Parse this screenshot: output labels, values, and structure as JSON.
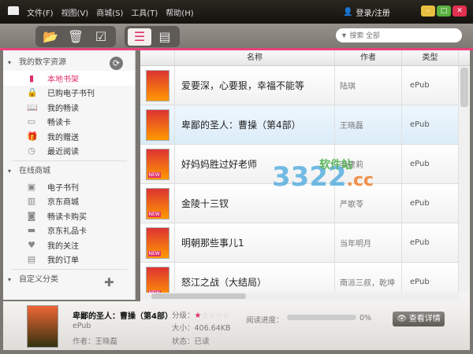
{
  "menu": {
    "items": [
      "文件(F)",
      "视图(V)",
      "商城(S)",
      "工具(T)",
      "帮助(H)"
    ],
    "login": "登录/注册"
  },
  "search": {
    "placeholder": "▼ 搜索 全部"
  },
  "sidebar": {
    "sections": [
      {
        "title": "我的数字资源",
        "items": [
          {
            "label": "本地书架",
            "icon": "bookshelf-icon"
          },
          {
            "label": "已购电子书刊",
            "icon": "bag-icon"
          },
          {
            "label": "我的畅读",
            "icon": "book-icon"
          },
          {
            "label": "畅读卡",
            "icon": "card-icon"
          },
          {
            "label": "我的赠送",
            "icon": "gift-icon"
          },
          {
            "label": "最近阅读",
            "icon": "clock-icon"
          }
        ]
      },
      {
        "title": "在线商城",
        "items": [
          {
            "label": "电子书刊",
            "icon": "ebook-icon"
          },
          {
            "label": "京东商城",
            "icon": "store-icon"
          },
          {
            "label": "畅读卡购买",
            "icon": "buy-card-icon"
          },
          {
            "label": "京东礼品卡",
            "icon": "giftcard-icon"
          },
          {
            "label": "我的关注",
            "icon": "heart-icon"
          },
          {
            "label": "我的订单",
            "icon": "order-icon"
          }
        ]
      },
      {
        "title": "自定义分类",
        "items": []
      }
    ]
  },
  "table": {
    "headers": [
      "名称",
      "作者",
      "类型"
    ],
    "rows": [
      {
        "title": "爱要深，心要狠，幸福不能等",
        "author": "陆琪",
        "type": "ePub"
      },
      {
        "title": "卑鄙的圣人：曹操（第4部）",
        "author": "王晓磊",
        "type": "ePub"
      },
      {
        "title": "好妈妈胜过好老师",
        "author": "尹建莉",
        "type": "ePub",
        "badge": "NEW"
      },
      {
        "title": "金陵十三钗",
        "author": "严歌苓",
        "type": "ePub",
        "badge": "NEW"
      },
      {
        "title": "明朝那些事儿1",
        "author": "当年明月",
        "type": "ePub",
        "badge": "NEW"
      },
      {
        "title": "怒江之战（大结局）",
        "author": "南派三叔，乾坤",
        "type": "ePub",
        "badge": "NEW"
      }
    ]
  },
  "detail": {
    "title": "卑鄙的圣人：曹操（第4部）",
    "format": "ePub",
    "author": "作者：王晓磊",
    "rating_label": "分级：",
    "rating": 1,
    "rating_max": 5,
    "size": "大小：406.64KB",
    "status": "状态：已读",
    "progress_label": "阅读进度：",
    "progress": "0%",
    "view_button": "查看详情"
  },
  "watermark": {
    "text": "3322",
    "suffix": ".cc",
    "tagline": "软件站"
  },
  "colors": {
    "accent": "#e0306a",
    "titlebar": "#1e1a15"
  }
}
